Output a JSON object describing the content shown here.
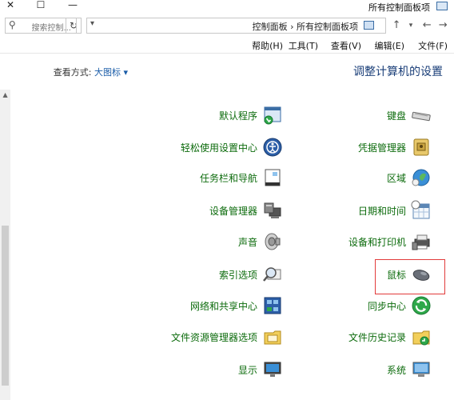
{
  "window": {
    "title": "所有控制面板项",
    "controls": {
      "minimize": "—",
      "maximize": "☐",
      "close": "✕"
    }
  },
  "address": {
    "breadcrumbs": "控制面板  ›  所有控制面板项",
    "search_placeholder": "搜索控制..."
  },
  "menu": [
    "文件(F)",
    "编辑(E)",
    "查看(V)",
    "工具(T)",
    "帮助(H)"
  ],
  "heading": "调整计算机的设置",
  "view_by": {
    "label": "查看方式:",
    "value": "大图标 ▾"
  },
  "items": [
    {
      "label": "键盘",
      "icon": "keyboard-icon"
    },
    {
      "label": "默认程序",
      "icon": "default-programs-icon"
    },
    {
      "label": "凭据管理器",
      "icon": "credential-manager-icon"
    },
    {
      "label": "轻松使用设置中心",
      "icon": "ease-of-access-icon"
    },
    {
      "label": "区域",
      "icon": "region-icon"
    },
    {
      "label": "任务栏和导航",
      "icon": "taskbar-icon"
    },
    {
      "label": "日期和时间",
      "icon": "calendar-icon"
    },
    {
      "label": "设备管理器",
      "icon": "device-manager-icon"
    },
    {
      "label": "设备和打印机",
      "icon": "printer-icon"
    },
    {
      "label": "声音",
      "icon": "sound-icon"
    },
    {
      "label": "鼠标",
      "icon": "mouse-icon"
    },
    {
      "label": "索引选项",
      "icon": "indexing-icon"
    },
    {
      "label": "同步中心",
      "icon": "sync-icon"
    },
    {
      "label": "网络和共享中心",
      "icon": "network-icon"
    },
    {
      "label": "文件历史记录",
      "icon": "file-history-icon"
    },
    {
      "label": "文件资源管理器选项",
      "icon": "folder-options-icon"
    },
    {
      "label": "系统",
      "icon": "system-icon"
    },
    {
      "label": "显示",
      "icon": "display-icon"
    }
  ]
}
